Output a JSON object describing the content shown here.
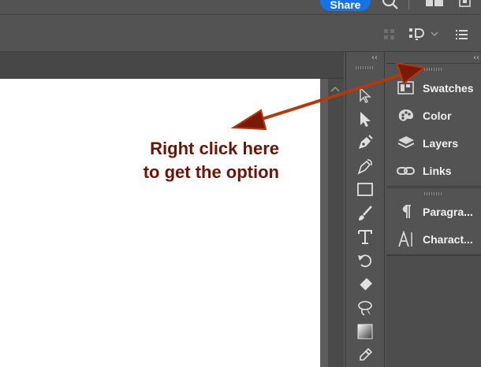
{
  "topbar": {
    "share_label": "Share"
  },
  "annotation": {
    "line1": "Right click here",
    "line2": "to get the option",
    "color": "#6e1306"
  },
  "toolbar": {
    "tools": [
      {
        "icon": "direct-selection-outline-icon"
      },
      {
        "icon": "selection-arrow-icon"
      },
      {
        "icon": "pen-icon"
      },
      {
        "icon": "curvature-pen-icon"
      },
      {
        "icon": "rectangle-icon"
      },
      {
        "icon": "paintbrush-icon"
      },
      {
        "icon": "type-icon",
        "glyph": "T"
      },
      {
        "icon": "rotate-icon"
      },
      {
        "icon": "eraser-icon"
      },
      {
        "icon": "lasso-icon"
      },
      {
        "icon": "gradient-icon"
      },
      {
        "icon": "eyedropper-icon"
      }
    ]
  },
  "panels": {
    "group1": [
      {
        "icon": "swatches-icon",
        "label": "Swatches"
      },
      {
        "icon": "color-palette-icon",
        "label": "Color"
      },
      {
        "icon": "layers-icon",
        "label": "Layers"
      },
      {
        "icon": "links-icon",
        "label": "Links"
      }
    ],
    "group2": [
      {
        "icon": "paragraph-icon",
        "label": "Paragra..."
      },
      {
        "icon": "character-icon",
        "label": "Charact..."
      }
    ]
  },
  "colors": {
    "accent": "#1473e6",
    "arrow": "#b13a0e",
    "ui_bg": "#535353"
  }
}
